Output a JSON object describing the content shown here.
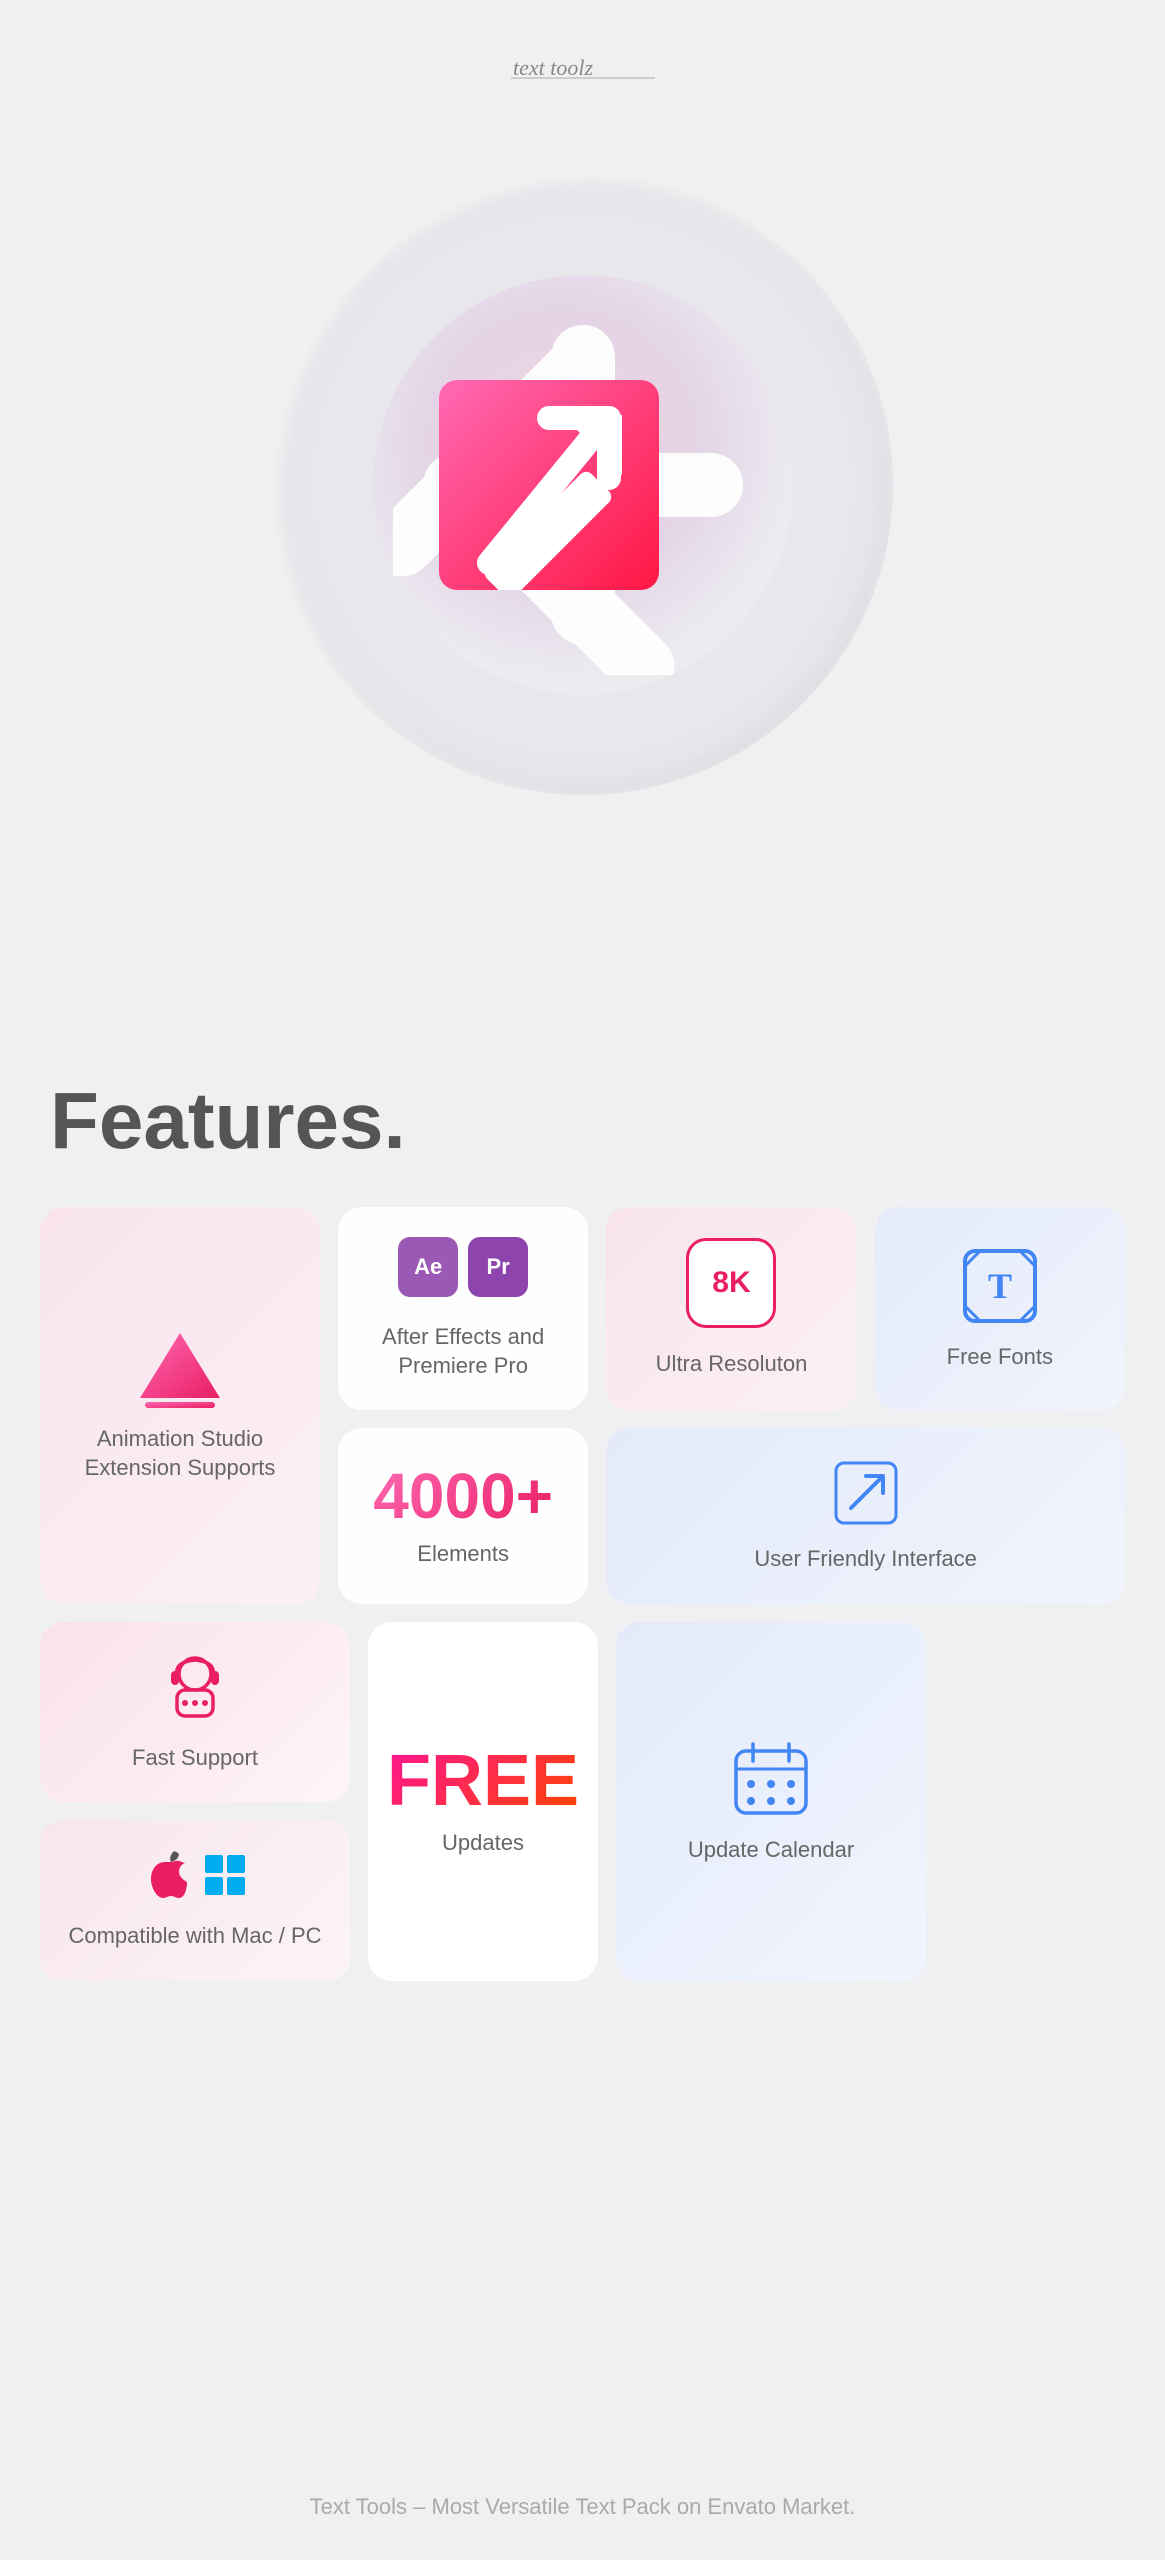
{
  "header": {
    "logo": "text-toolz"
  },
  "hero": {
    "alt": "Text Toolz logo mark - arrow and asterisk"
  },
  "features": {
    "title": "Features.",
    "cards": {
      "animation": {
        "label": "Animation Studio\nExtension Supports"
      },
      "ae_pr": {
        "ae_label": "Ae",
        "pr_label": "Pr",
        "description": "After Effects and Premiere Pro"
      },
      "ultra_res": {
        "badge": "8K",
        "label": "Ultra Resoluton"
      },
      "free_fonts": {
        "label": "Free Fonts"
      },
      "elements": {
        "count": "4000+",
        "label": "Elements"
      },
      "user_interface": {
        "label": "User Friendly Interface"
      },
      "fast_support": {
        "label": "Fast Support"
      },
      "free_updates": {
        "text": "FREE",
        "label": "Updates"
      },
      "update_calendar": {
        "label": "Update Calendar"
      },
      "mac_pc": {
        "label": "Compatible with Mac / PC"
      }
    }
  },
  "footer": {
    "text": "Text Tools – Most Versatile Text Pack on Envato Market."
  }
}
